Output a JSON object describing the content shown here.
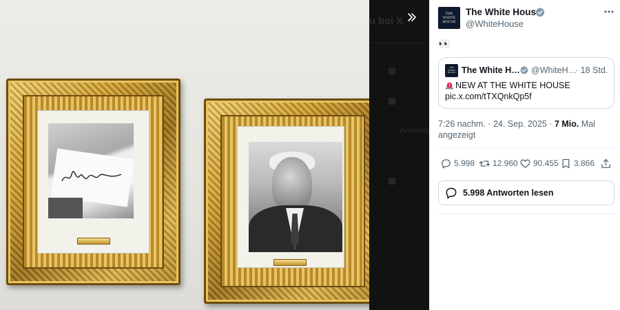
{
  "media": {
    "description_label": "",
    "dim_panel_text_top": "u bei X",
    "dim_panel_text_mid": "Anmelde"
  },
  "tweet": {
    "author": {
      "name": "The White House",
      "handle": "@WhiteHouse",
      "avatar_line1": "THE",
      "avatar_line2": "WHITE",
      "avatar_line3": "HOUSE"
    },
    "text": "👀",
    "quote": {
      "name": "The White H…",
      "handle": "@WhiteH…",
      "separator": "·",
      "time": "18 Std.",
      "line1": "NEW AT THE WHITE HOUSE",
      "line2": "pic.x.com/tTXQnkQp5f"
    },
    "meta": {
      "time": "7:26 nachm.",
      "dot": "·",
      "date": "24. Sep. 2025",
      "views": "7 Mio.",
      "views_label": "Mal angezeigt"
    },
    "stats": {
      "replies": "5.998",
      "reposts": "12.960",
      "likes": "90.455",
      "bookmarks": "3.866"
    },
    "read_replies_label": "5.998 Antworten lesen"
  },
  "colors": {
    "verified_blue": "#829aab",
    "secondary_text": "#536471",
    "border": "#cfd9de",
    "siren_red": "#e0245e"
  },
  "icons": [
    "collapse-icon",
    "verified-icon",
    "more-icon",
    "reply-icon",
    "repost-icon",
    "like-icon",
    "bookmark-icon",
    "share-icon",
    "chat-bubble-icon",
    "siren-icon"
  ]
}
